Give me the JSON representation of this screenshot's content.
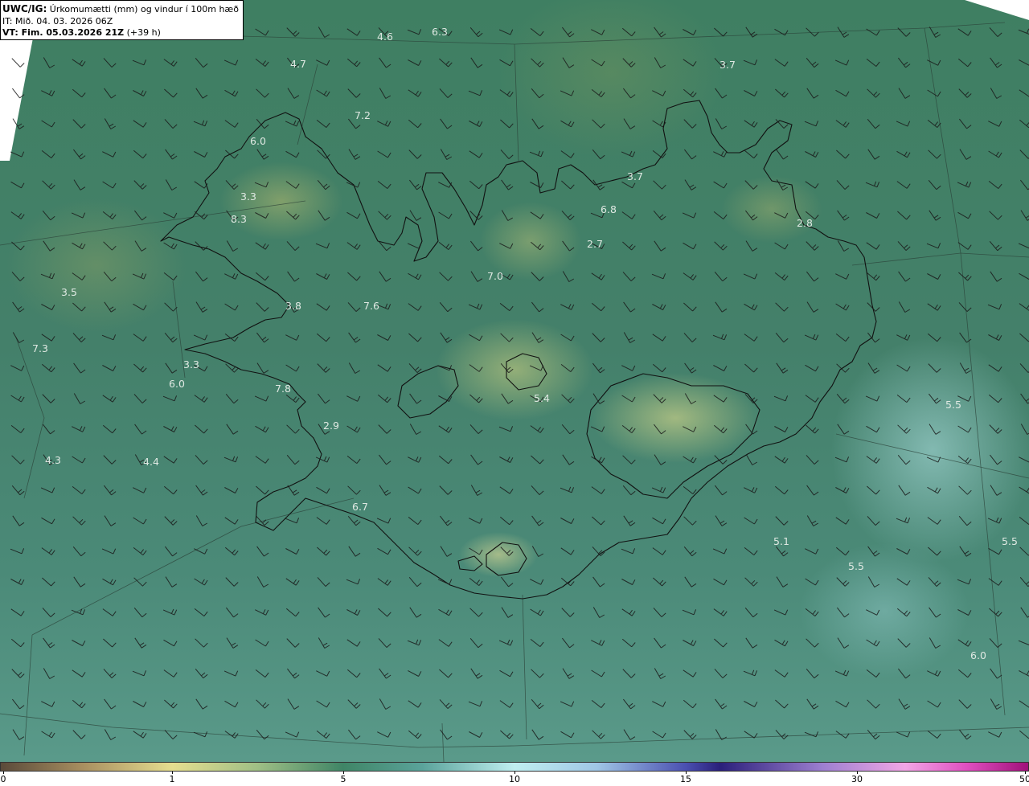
{
  "header": {
    "title_prefix": "UWC/IG:",
    "title_text": "Úrkomumætti (mm) og vindur í 100m hæð",
    "init_time": "IT: Mið. 04. 03. 2026 06Z",
    "valid_prefix": "VT: Fim. 05.03.2026 21Z",
    "valid_offset": "(+39 h)"
  },
  "map_labels": [
    {
      "text": "4.6"
    },
    {
      "text": "6.3"
    },
    {
      "text": "4.7"
    },
    {
      "text": "3.7"
    },
    {
      "text": "7.2"
    },
    {
      "text": "6.0"
    },
    {
      "text": "3.7"
    },
    {
      "text": "3.3"
    },
    {
      "text": "6.8"
    },
    {
      "text": "8.3"
    },
    {
      "text": "2.8"
    },
    {
      "text": "2.7"
    },
    {
      "text": "7.0"
    },
    {
      "text": "3.5"
    },
    {
      "text": "3.8"
    },
    {
      "text": "7.6"
    },
    {
      "text": "7.3"
    },
    {
      "text": "3.3"
    },
    {
      "text": "6.0"
    },
    {
      "text": "7.8"
    },
    {
      "text": "5.4"
    },
    {
      "text": "5.5"
    },
    {
      "text": "2.9"
    },
    {
      "text": "4.3"
    },
    {
      "text": "4.4"
    },
    {
      "text": "6.7"
    },
    {
      "text": "5.1"
    },
    {
      "text": "5.5"
    },
    {
      "text": "5.5"
    },
    {
      "text": "6.0"
    }
  ],
  "colorbar": {
    "ticks": [
      "0",
      "1",
      "5",
      "10",
      "15",
      "30",
      "50"
    ]
  }
}
